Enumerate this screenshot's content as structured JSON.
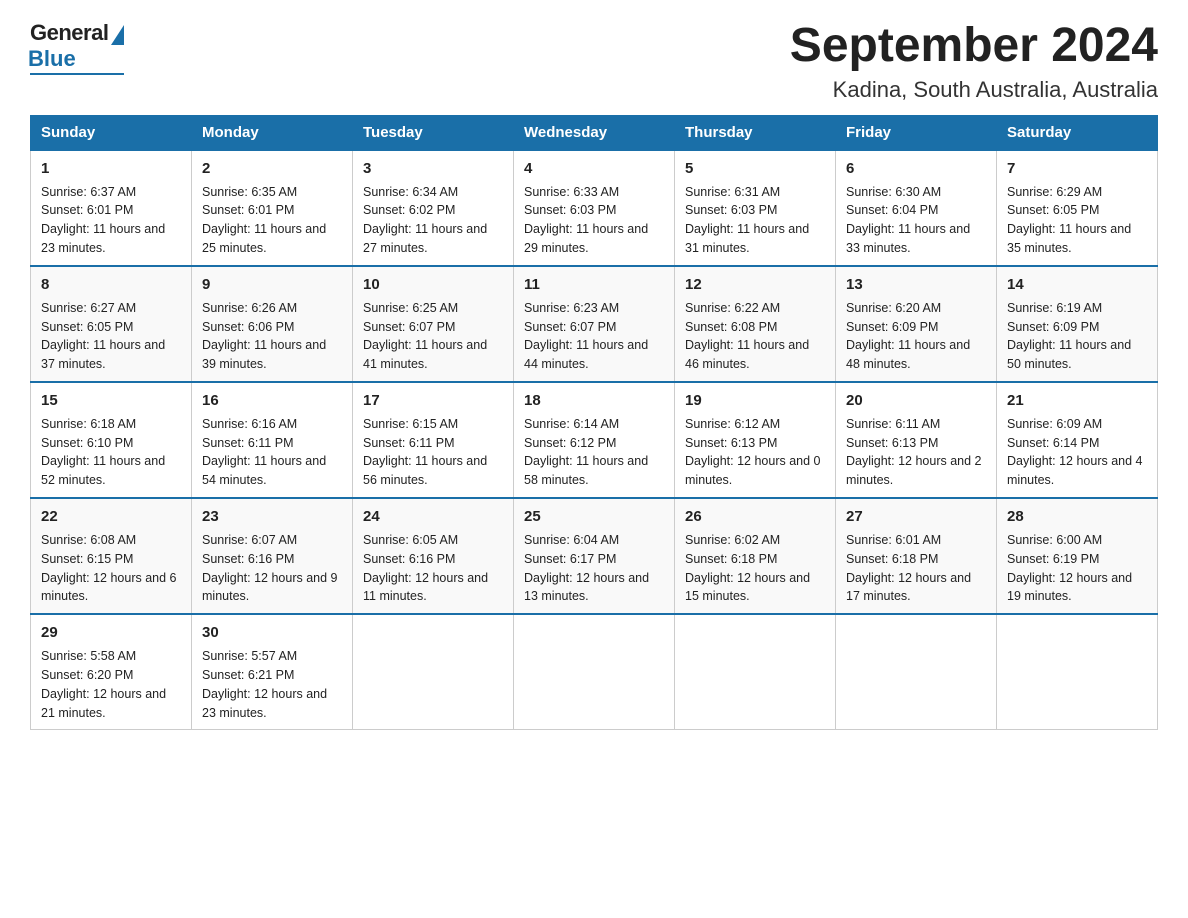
{
  "header": {
    "logo_general": "General",
    "logo_blue": "Blue",
    "title": "September 2024",
    "subtitle": "Kadina, South Australia, Australia"
  },
  "days_of_week": [
    "Sunday",
    "Monday",
    "Tuesday",
    "Wednesday",
    "Thursday",
    "Friday",
    "Saturday"
  ],
  "weeks": [
    [
      {
        "day": "1",
        "sunrise": "6:37 AM",
        "sunset": "6:01 PM",
        "daylight": "11 hours and 23 minutes."
      },
      {
        "day": "2",
        "sunrise": "6:35 AM",
        "sunset": "6:01 PM",
        "daylight": "11 hours and 25 minutes."
      },
      {
        "day": "3",
        "sunrise": "6:34 AM",
        "sunset": "6:02 PM",
        "daylight": "11 hours and 27 minutes."
      },
      {
        "day": "4",
        "sunrise": "6:33 AM",
        "sunset": "6:03 PM",
        "daylight": "11 hours and 29 minutes."
      },
      {
        "day": "5",
        "sunrise": "6:31 AM",
        "sunset": "6:03 PM",
        "daylight": "11 hours and 31 minutes."
      },
      {
        "day": "6",
        "sunrise": "6:30 AM",
        "sunset": "6:04 PM",
        "daylight": "11 hours and 33 minutes."
      },
      {
        "day": "7",
        "sunrise": "6:29 AM",
        "sunset": "6:05 PM",
        "daylight": "11 hours and 35 minutes."
      }
    ],
    [
      {
        "day": "8",
        "sunrise": "6:27 AM",
        "sunset": "6:05 PM",
        "daylight": "11 hours and 37 minutes."
      },
      {
        "day": "9",
        "sunrise": "6:26 AM",
        "sunset": "6:06 PM",
        "daylight": "11 hours and 39 minutes."
      },
      {
        "day": "10",
        "sunrise": "6:25 AM",
        "sunset": "6:07 PM",
        "daylight": "11 hours and 41 minutes."
      },
      {
        "day": "11",
        "sunrise": "6:23 AM",
        "sunset": "6:07 PM",
        "daylight": "11 hours and 44 minutes."
      },
      {
        "day": "12",
        "sunrise": "6:22 AM",
        "sunset": "6:08 PM",
        "daylight": "11 hours and 46 minutes."
      },
      {
        "day": "13",
        "sunrise": "6:20 AM",
        "sunset": "6:09 PM",
        "daylight": "11 hours and 48 minutes."
      },
      {
        "day": "14",
        "sunrise": "6:19 AM",
        "sunset": "6:09 PM",
        "daylight": "11 hours and 50 minutes."
      }
    ],
    [
      {
        "day": "15",
        "sunrise": "6:18 AM",
        "sunset": "6:10 PM",
        "daylight": "11 hours and 52 minutes."
      },
      {
        "day": "16",
        "sunrise": "6:16 AM",
        "sunset": "6:11 PM",
        "daylight": "11 hours and 54 minutes."
      },
      {
        "day": "17",
        "sunrise": "6:15 AM",
        "sunset": "6:11 PM",
        "daylight": "11 hours and 56 minutes."
      },
      {
        "day": "18",
        "sunrise": "6:14 AM",
        "sunset": "6:12 PM",
        "daylight": "11 hours and 58 minutes."
      },
      {
        "day": "19",
        "sunrise": "6:12 AM",
        "sunset": "6:13 PM",
        "daylight": "12 hours and 0 minutes."
      },
      {
        "day": "20",
        "sunrise": "6:11 AM",
        "sunset": "6:13 PM",
        "daylight": "12 hours and 2 minutes."
      },
      {
        "day": "21",
        "sunrise": "6:09 AM",
        "sunset": "6:14 PM",
        "daylight": "12 hours and 4 minutes."
      }
    ],
    [
      {
        "day": "22",
        "sunrise": "6:08 AM",
        "sunset": "6:15 PM",
        "daylight": "12 hours and 6 minutes."
      },
      {
        "day": "23",
        "sunrise": "6:07 AM",
        "sunset": "6:16 PM",
        "daylight": "12 hours and 9 minutes."
      },
      {
        "day": "24",
        "sunrise": "6:05 AM",
        "sunset": "6:16 PM",
        "daylight": "12 hours and 11 minutes."
      },
      {
        "day": "25",
        "sunrise": "6:04 AM",
        "sunset": "6:17 PM",
        "daylight": "12 hours and 13 minutes."
      },
      {
        "day": "26",
        "sunrise": "6:02 AM",
        "sunset": "6:18 PM",
        "daylight": "12 hours and 15 minutes."
      },
      {
        "day": "27",
        "sunrise": "6:01 AM",
        "sunset": "6:18 PM",
        "daylight": "12 hours and 17 minutes."
      },
      {
        "day": "28",
        "sunrise": "6:00 AM",
        "sunset": "6:19 PM",
        "daylight": "12 hours and 19 minutes."
      }
    ],
    [
      {
        "day": "29",
        "sunrise": "5:58 AM",
        "sunset": "6:20 PM",
        "daylight": "12 hours and 21 minutes."
      },
      {
        "day": "30",
        "sunrise": "5:57 AM",
        "sunset": "6:21 PM",
        "daylight": "12 hours and 23 minutes."
      },
      null,
      null,
      null,
      null,
      null
    ]
  ],
  "labels": {
    "sunrise": "Sunrise:",
    "sunset": "Sunset:",
    "daylight": "Daylight:"
  }
}
